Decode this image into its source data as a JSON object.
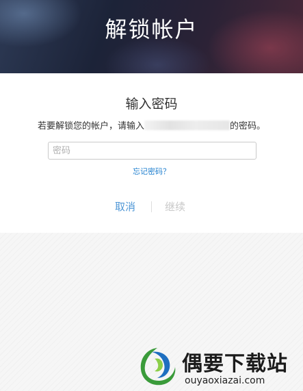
{
  "header": {
    "title": "解锁帐户"
  },
  "panel": {
    "title": "输入密码",
    "instruction_prefix": "若要解锁您的帐户，请输入",
    "instruction_suffix": "的密码。",
    "password_placeholder": "密码",
    "password_value": "",
    "forgot_label": "忘记密码？",
    "cancel_label": "取消",
    "continue_label": "继续"
  },
  "colors": {
    "link_blue": "#1f7fcf",
    "cancel_blue": "#4f97d6",
    "disabled_gray": "#c8c8c8"
  },
  "watermark": {
    "title": "偶要下载站",
    "url": "ouyaoxiazai.com"
  }
}
